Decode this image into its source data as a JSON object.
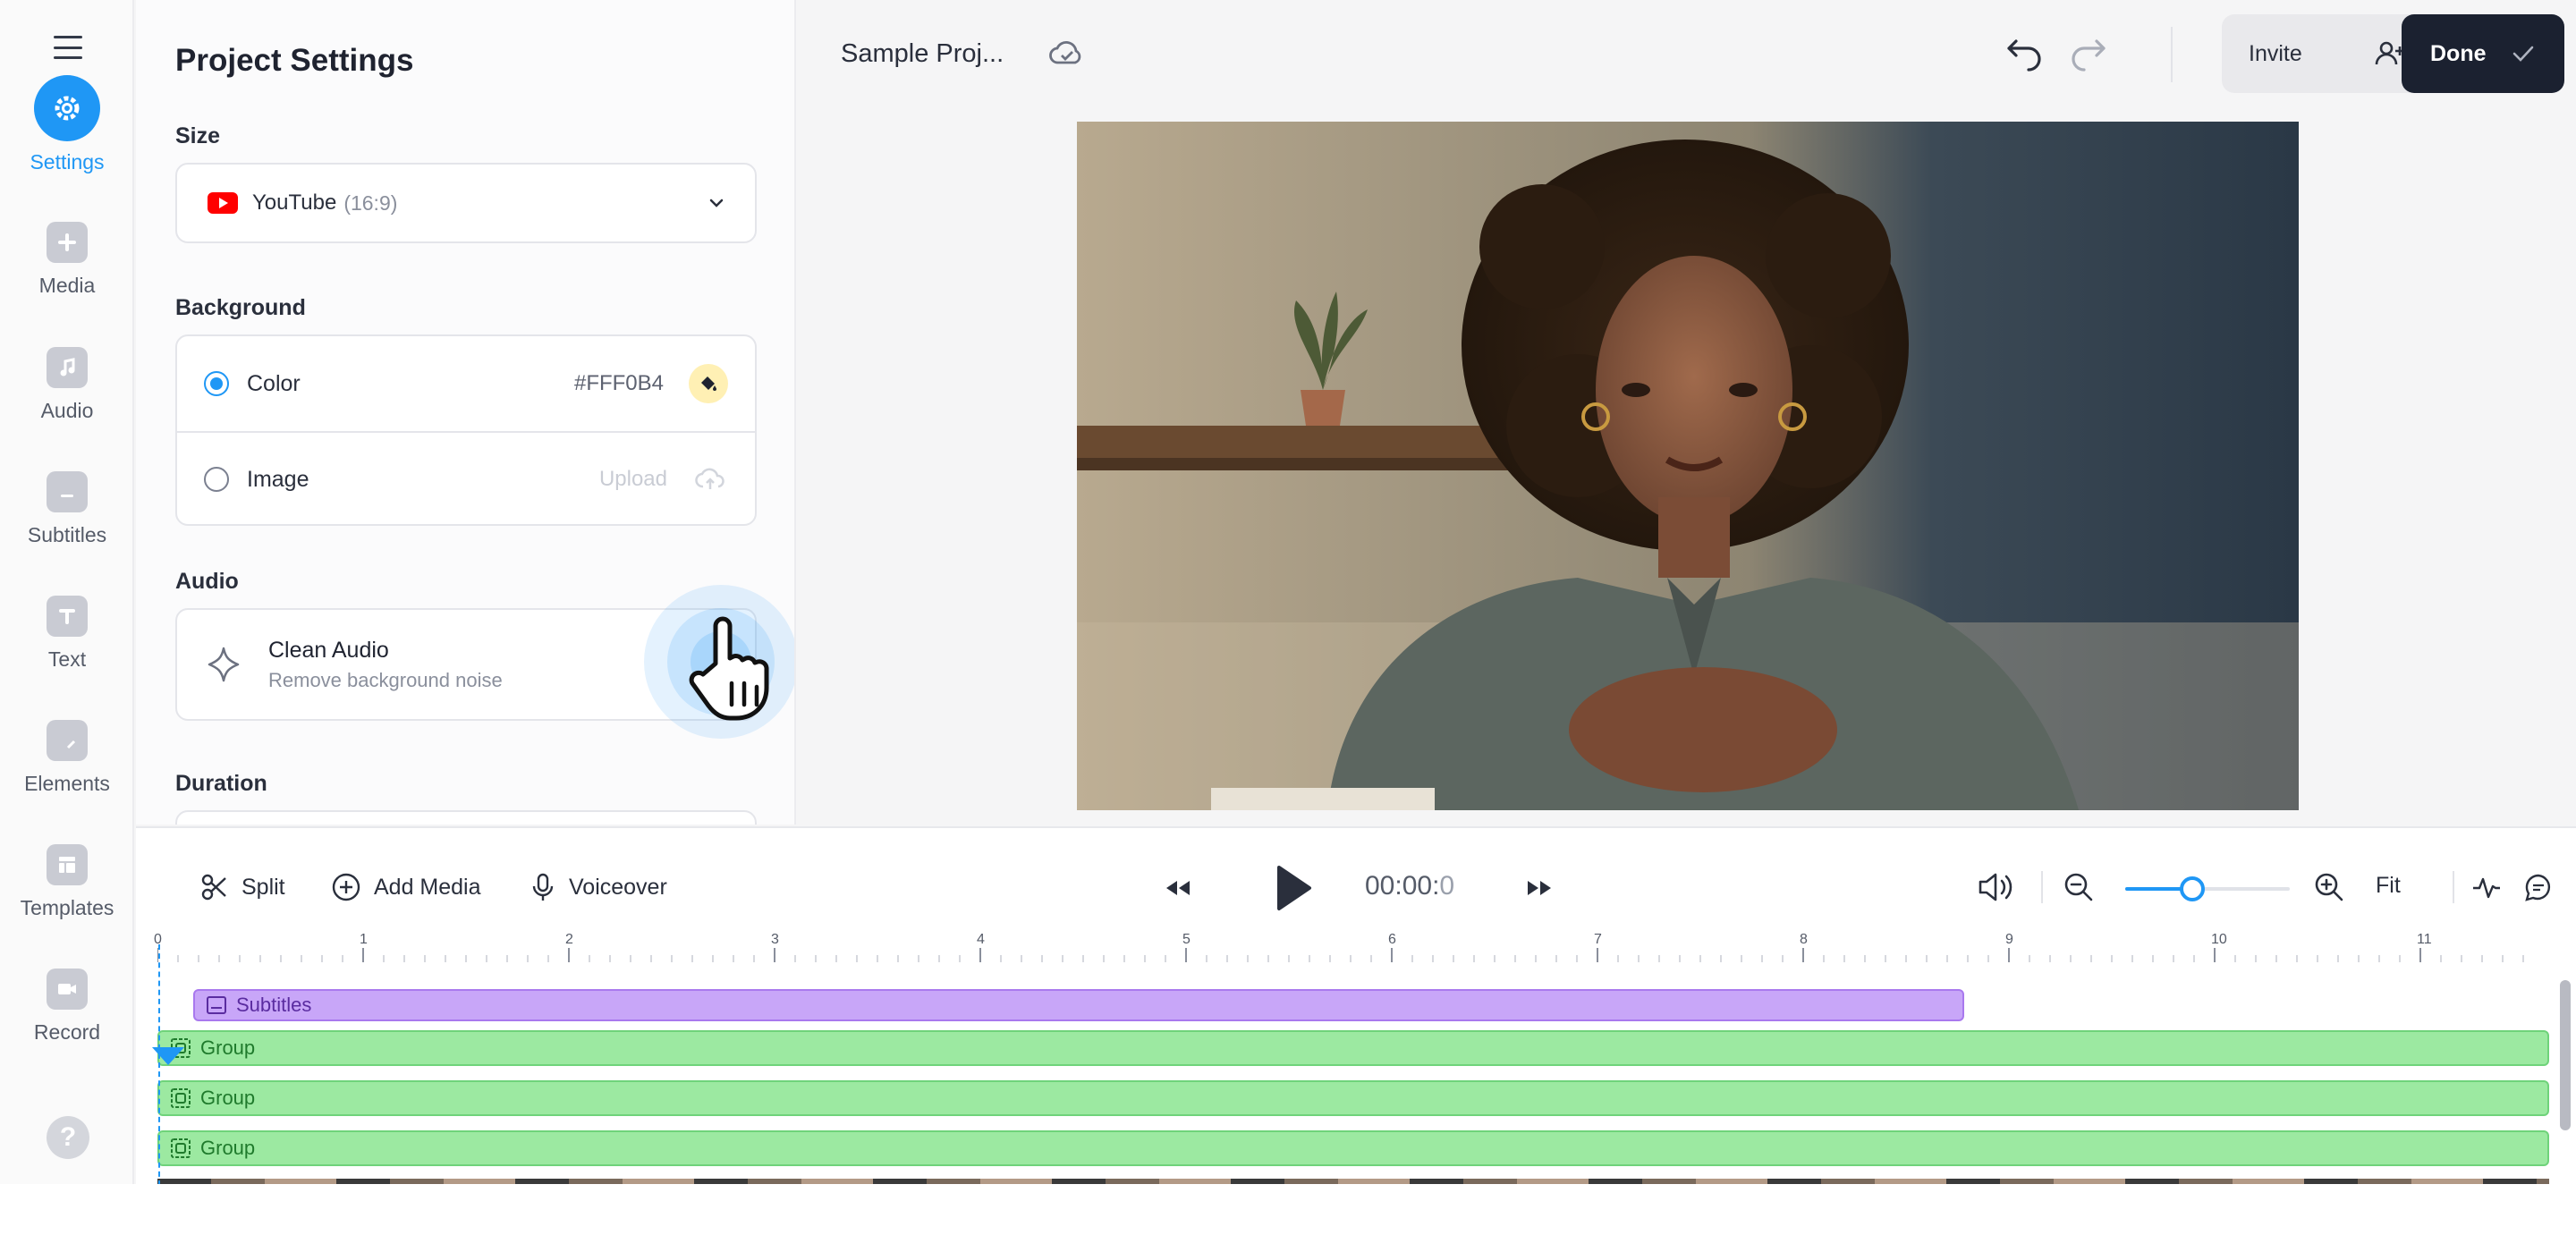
{
  "rail": {
    "items": [
      {
        "label": "Settings",
        "icon": "gear-icon",
        "active": true
      },
      {
        "label": "Media",
        "icon": "plus-icon"
      },
      {
        "label": "Audio",
        "icon": "music-note-icon"
      },
      {
        "label": "Subtitles",
        "icon": "subtitles-icon"
      },
      {
        "label": "Text",
        "icon": "text-icon"
      },
      {
        "label": "Elements",
        "icon": "sticker-icon"
      },
      {
        "label": "Templates",
        "icon": "layout-icon"
      },
      {
        "label": "Record",
        "icon": "camera-icon"
      }
    ],
    "help": "?"
  },
  "panel": {
    "title": "Project Settings",
    "size": {
      "label": "Size",
      "value": "YouTube",
      "ratio": "(16:9)"
    },
    "background": {
      "label": "Background",
      "color_option": "Color",
      "color_value": "#FFF0B4",
      "image_option": "Image",
      "upload_label": "Upload",
      "selected": "Color"
    },
    "audio": {
      "label": "Audio",
      "clean_title": "Clean Audio",
      "clean_sub": "Remove background noise"
    },
    "duration": {
      "label": "Duration"
    }
  },
  "topbar": {
    "project_name": "Sample Proj...",
    "invite_label": "Invite",
    "done_label": "Done"
  },
  "timeline": {
    "split_label": "Split",
    "add_media_label": "Add Media",
    "voiceover_label": "Voiceover",
    "time_main": "00:00:",
    "time_ms": "0",
    "fit_label": "Fit",
    "zoom_level": 0.34,
    "ruler_ticks": [
      "0",
      "1",
      "2",
      "3",
      "4",
      "5",
      "6",
      "7",
      "8",
      "9",
      "10",
      "11"
    ],
    "tracks": [
      {
        "type": "subtitles",
        "label": "Subtitles"
      },
      {
        "type": "group",
        "label": "Group"
      },
      {
        "type": "group",
        "label": "Group"
      },
      {
        "type": "group",
        "label": "Group"
      }
    ]
  },
  "colors": {
    "accent": "#1f97f5",
    "done_bg": "#1b2130",
    "subtitle_track": "#c8a6f8",
    "group_track": "#9ce9a1"
  }
}
